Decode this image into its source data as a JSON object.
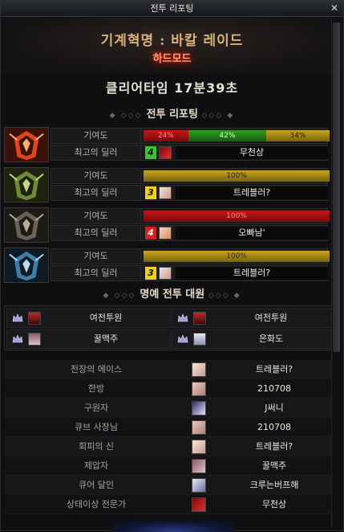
{
  "window": {
    "title": "전투 리포팅",
    "close_icon": "close-icon"
  },
  "header": {
    "raid_title": "기계혁명 : 바칼 레이드",
    "difficulty": "하드모드",
    "clear_time": "클리어타임  17분39초"
  },
  "report": {
    "section_title": "전투 리포팅",
    "contribution_label": "기여도",
    "top_dealer_label": "최고의 딜러",
    "raiders": [
      {
        "portrait": "flame-portrait-icon",
        "segments": [
          {
            "text": "24%",
            "value": 24,
            "color": "red"
          },
          {
            "text": "42%",
            "value": 42,
            "color": "green"
          },
          {
            "text": "34%",
            "value": 34,
            "color": "gold"
          }
        ],
        "rank": "4",
        "rank_color": "green",
        "dealer": "무천상",
        "dealer_icon": "red-dealer-icon"
      },
      {
        "portrait": "nature-portrait-icon",
        "segments": [
          {
            "text": "100%",
            "value": 100,
            "color": "gold"
          }
        ],
        "rank": "3",
        "rank_color": "yellow",
        "dealer": "트레블러?",
        "dealer_icon": "pale-dealer-icon"
      },
      {
        "portrait": "stone-portrait-icon",
        "segments": [
          {
            "text": "100%",
            "value": 100,
            "color": "red"
          }
        ],
        "rank": "4",
        "rank_color": "red",
        "dealer": "오빠남'",
        "dealer_icon": "peach-dealer-icon"
      },
      {
        "portrait": "ice-portrait-icon",
        "segments": [
          {
            "text": "100%",
            "value": 100,
            "color": "gold"
          }
        ],
        "rank": "3",
        "rank_color": "yellow",
        "dealer": "트레블러?",
        "dealer_icon": "pale-dealer-icon"
      }
    ]
  },
  "honor": {
    "section_title": "명예 전투 대원",
    "members": [
      {
        "name": "여전투원",
        "icon": "crown-icon"
      },
      {
        "name": "여전투원",
        "icon": "crown-icon"
      },
      {
        "name": "꿀맥주",
        "icon": "crown-icon"
      },
      {
        "name": "은화도",
        "icon": "crown-icon"
      }
    ]
  },
  "awards": [
    {
      "title": "전장의 에이스",
      "name": "트레블러?"
    },
    {
      "title": "한방",
      "name": "210708"
    },
    {
      "title": "구원자",
      "name": "J써니"
    },
    {
      "title": "큐브 사장님",
      "name": "210708"
    },
    {
      "title": "회피의 신",
      "name": "트레블러?"
    },
    {
      "title": "제압자",
      "name": "꿀맥주"
    },
    {
      "title": "큐어 달인",
      "name": "크루는버프해"
    },
    {
      "title": "상태이상 전문가",
      "name": "무천상"
    }
  ]
}
